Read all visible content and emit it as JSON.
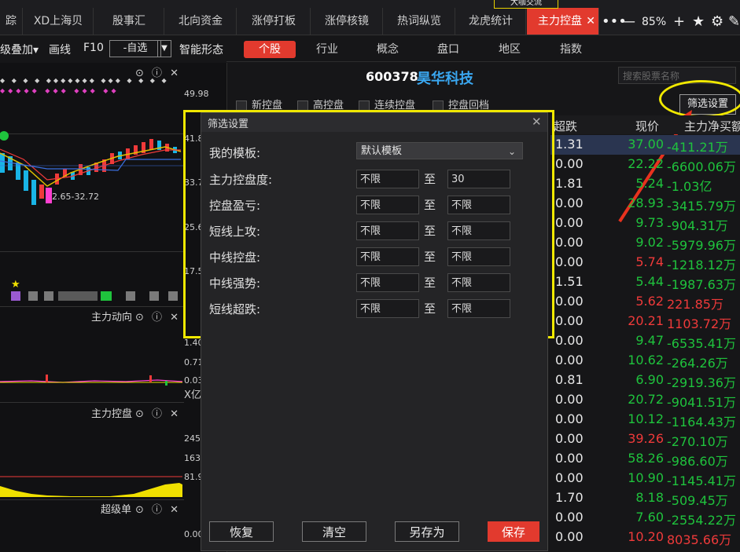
{
  "top_tabs": [
    {
      "label": "踪"
    },
    {
      "label": "XD上海贝"
    },
    {
      "label": "股事汇"
    },
    {
      "label": "北向资金"
    },
    {
      "label": "涨停打板"
    },
    {
      "label": "涨停核镜"
    },
    {
      "label": "热词纵览"
    },
    {
      "label": "龙虎统计"
    },
    {
      "label": "主力控盘",
      "active": true
    }
  ],
  "top_toolbar": {
    "zoom": "85%",
    "corner_text": "大咖交流"
  },
  "left_toolbar": {
    "overlay": "级叠加",
    "draw": "画线",
    "f10": "F10",
    "self_select": "-自选",
    "smart": "智能形态"
  },
  "left_chart": {
    "price_labels": [
      "49.98",
      "41.8",
      "33.7",
      "25.6",
      "17.5"
    ],
    "range_label": "2.65-32.72",
    "pane1": {
      "title": "主力动向",
      "labels": [
        "1.40",
        "0.71",
        "0.03",
        "X亿"
      ]
    },
    "pane2": {
      "title": "主力控盘",
      "labels": [
        "245.",
        "163.",
        "81.9"
      ]
    },
    "pane3": {
      "title": "超级单",
      "labels": [
        "0.00"
      ]
    }
  },
  "category_tabs": [
    "个股",
    "行业",
    "概念",
    "盘口",
    "地区",
    "指数"
  ],
  "stock": {
    "code": "600378",
    "name": "昊华科技"
  },
  "search": {
    "placeholder": "搜索股票名称"
  },
  "filters": [
    "新控盘",
    "高控盘",
    "连续控盘",
    "控盘回档"
  ],
  "filter_button": "筛选设置",
  "table": {
    "headers": [
      "超跌",
      "现价",
      "主力净买额"
    ],
    "rows": [
      {
        "a": "1.31",
        "price": "37.00",
        "net": "-411.21万",
        "pc": "g",
        "nc": "g"
      },
      {
        "a": "0.00",
        "price": "22.22",
        "net": "-6600.06万",
        "pc": "g",
        "nc": "g"
      },
      {
        "a": "1.81",
        "price": "5.24",
        "net": "-1.03亿",
        "pc": "g",
        "nc": "g"
      },
      {
        "a": "0.00",
        "price": "28.93",
        "net": "-3415.79万",
        "pc": "g",
        "nc": "g"
      },
      {
        "a": "0.00",
        "price": "9.73",
        "net": "-904.31万",
        "pc": "g",
        "nc": "g"
      },
      {
        "a": "0.00",
        "price": "9.02",
        "net": "-5979.96万",
        "pc": "g",
        "nc": "g"
      },
      {
        "a": "0.00",
        "price": "5.74",
        "net": "-1218.12万",
        "pc": "r",
        "nc": "g"
      },
      {
        "a": "1.51",
        "price": "5.44",
        "net": "-1987.63万",
        "pc": "g",
        "nc": "g"
      },
      {
        "a": "0.00",
        "price": "5.62",
        "net": "221.85万",
        "pc": "r",
        "nc": "r"
      },
      {
        "a": "0.00",
        "price": "20.21",
        "net": "1103.72万",
        "pc": "r",
        "nc": "r"
      },
      {
        "a": "0.00",
        "price": "9.47",
        "net": "-6535.41万",
        "pc": "g",
        "nc": "g"
      },
      {
        "a": "0.00",
        "price": "10.62",
        "net": "-264.26万",
        "pc": "g",
        "nc": "g"
      },
      {
        "a": "0.81",
        "price": "6.90",
        "net": "-2919.36万",
        "pc": "g",
        "nc": "g"
      },
      {
        "a": "0.00",
        "price": "20.72",
        "net": "-9041.51万",
        "pc": "g",
        "nc": "g"
      },
      {
        "a": "0.00",
        "price": "10.12",
        "net": "-1164.43万",
        "pc": "g",
        "nc": "g"
      },
      {
        "a": "0.00",
        "price": "39.26",
        "net": "-270.10万",
        "pc": "r",
        "nc": "g"
      },
      {
        "a": "0.00",
        "price": "58.26",
        "net": "-986.60万",
        "pc": "g",
        "nc": "g"
      },
      {
        "a": "0.00",
        "price": "10.90",
        "net": "-1145.41万",
        "pc": "g",
        "nc": "g"
      },
      {
        "a": "1.70",
        "price": "8.18",
        "net": "-509.45万",
        "pc": "g",
        "nc": "g"
      },
      {
        "a": "0.00",
        "price": "7.60",
        "net": "-2554.22万",
        "pc": "g",
        "nc": "g"
      },
      {
        "a": "0.00",
        "price": "10.20",
        "net": "8035.66万",
        "pc": "r",
        "nc": "r"
      }
    ]
  },
  "dialog": {
    "title": "筛选设置",
    "template_label": "我的模板:",
    "template_value": "默认模板",
    "to": "至",
    "fields": [
      {
        "label": "主力控盘度:",
        "from": "不限",
        "to": "30"
      },
      {
        "label": "控盘盈亏:",
        "from": "不限",
        "to": "不限"
      },
      {
        "label": "短线上攻:",
        "from": "不限",
        "to": "不限"
      },
      {
        "label": "中线控盘:",
        "from": "不限",
        "to": "不限"
      },
      {
        "label": "中线强势:",
        "from": "不限",
        "to": "不限"
      },
      {
        "label": "短线超跌:",
        "from": "不限",
        "to": "不限"
      }
    ],
    "buttons": {
      "restore": "恢复",
      "clear": "清空",
      "save_as": "另存为",
      "save": "保存"
    }
  },
  "colors": {
    "accent": "#e23a2e",
    "up": "#ef3a3a",
    "down": "#1fc33d",
    "highlight": "#f0e800",
    "stock_name": "#3aa7f0"
  }
}
